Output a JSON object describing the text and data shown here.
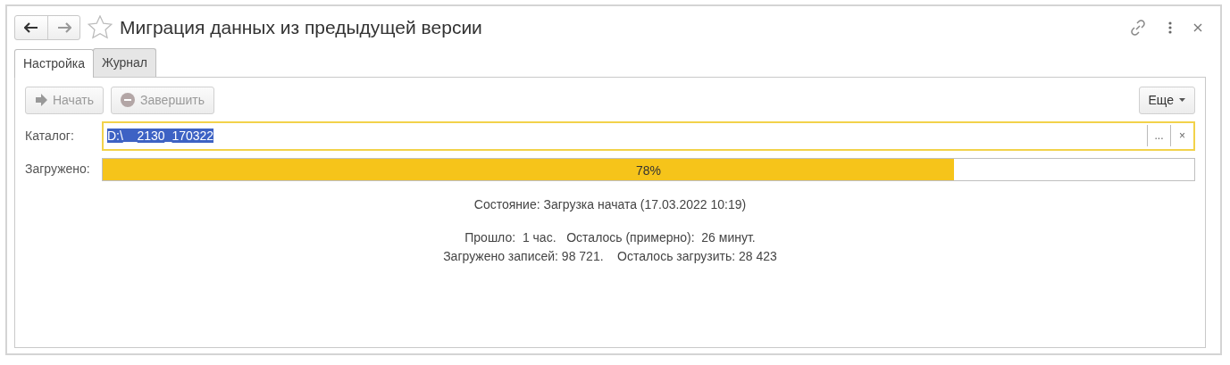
{
  "window": {
    "title": "Миграция данных из предыдущей версии",
    "favorite": false
  },
  "tabs": [
    {
      "label": "Настройка",
      "selected": true
    },
    {
      "label": "Журнал",
      "selected": false
    }
  ],
  "toolbar": {
    "buttons": [
      {
        "label": "Начать",
        "kind": "start",
        "disabled": true
      },
      {
        "label": "Завершить",
        "kind": "stop",
        "disabled": true
      }
    ],
    "more": "Еще"
  },
  "catalog": {
    "label": "Каталог:",
    "value": "D:\\__2130_170322",
    "selected_text": true,
    "choose": "...",
    "clear": "×"
  },
  "progress": {
    "label": "Загружено:",
    "level": 0.78,
    "reading": "78%"
  },
  "status": "Состояние: Загрузка начата (17.03.2022 10:19)",
  "stats": [
    "Прошло:  1 час.   Осталось (примерно):  26 минут.",
    "Загружено записей: 98 721.    Осталось загрузить: 28 423"
  ]
}
